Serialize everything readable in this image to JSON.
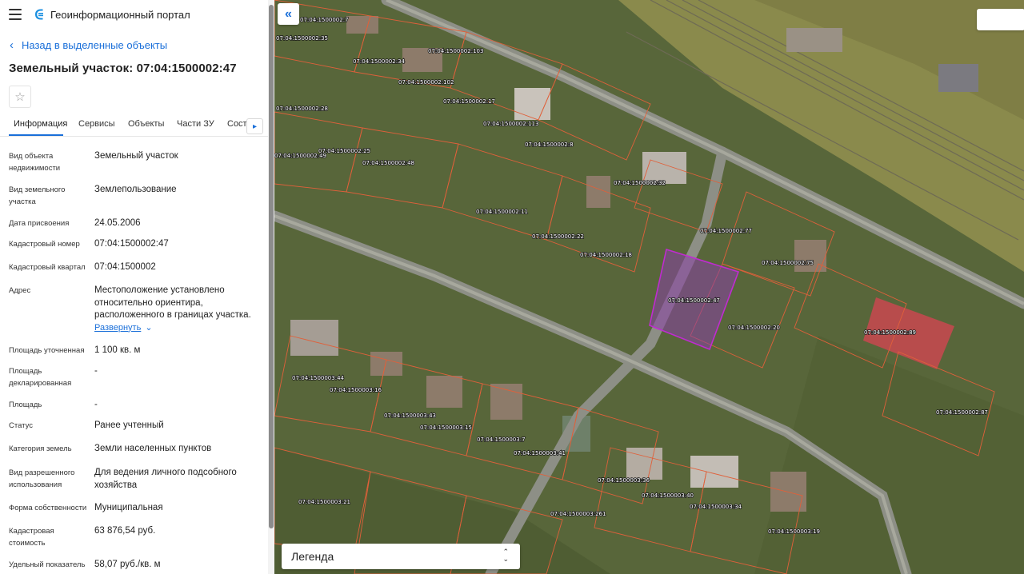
{
  "app": {
    "title": "Геоинформационный портал"
  },
  "panel": {
    "back_label": "Назад в выделенные объекты",
    "object_title": "Земельный участок: 07:04:1500002:47",
    "tabs": [
      "Информация",
      "Сервисы",
      "Объекты",
      "Части ЗУ",
      "Соста"
    ],
    "properties": [
      {
        "label": "Вид объекта недвижимости",
        "value": "Земельный участок"
      },
      {
        "label": "Вид земельного участка",
        "value": "Землепользование"
      },
      {
        "label": "Дата присвоения",
        "value": "24.05.2006"
      },
      {
        "label": "Кадастровый номер",
        "value": "07:04:1500002:47"
      },
      {
        "label": "Кадастровый квартал",
        "value": "07:04:1500002"
      },
      {
        "label": "Адрес",
        "value": "Местоположение установлено относительно ориентира, расположенного в границах участка.",
        "link": "Развернуть"
      },
      {
        "label": "Площадь уточненная",
        "value": "1 100 кв. м"
      },
      {
        "label": "Площадь декларированная",
        "value": "-"
      },
      {
        "label": "Площадь",
        "value": "-"
      },
      {
        "label": "Статус",
        "value": "Ранее учтенный"
      },
      {
        "label": "Категория земель",
        "value": "Земли населенных пунктов"
      },
      {
        "label": "Вид разрешенного использования",
        "value": "Для ведения личного подсобного хозяйства"
      },
      {
        "label": "Форма собственности",
        "value": "Муниципальная"
      },
      {
        "label": "Кадастровая стоимость",
        "value": "63 876,54 руб."
      },
      {
        "label": "Удельный показатель",
        "value": "58,07 руб./кв. м"
      }
    ]
  },
  "map": {
    "legend_label": "Легенда",
    "parcel_labels": [
      "07:04:1500002:7",
      "07:04:1500002:35",
      "07:04:1500002:34",
      "07:04:1500002:103",
      "07:04:1500002:102",
      "07:04:1500002:17",
      "07:04:1500002:28",
      "07:04:1500002:113",
      "07:04:1500002:8",
      "07:04:1500002:49",
      "07:04:1500002:25",
      "07:04:1500002:48",
      "07:04:1500002:32",
      "07:04:1500002:11",
      "07:04:1500002:22",
      "07:04:1500002:77",
      "07:04:1500002:18",
      "07:04:1500002:75",
      "07:04:1500002:47",
      "07:04:1500002:20",
      "07:04:1500002:89",
      "07:04:1500003:44",
      "07:04:1500003:16",
      "07:04:1500003:43",
      "07:04:1500003:15",
      "07:04:1500003:7",
      "07:04:1500003:41",
      "07:04:1500002:87",
      "07:04:1500003:36",
      "07:04:1500003:40",
      "07:04:1500003:34",
      "07:04:1500003:21",
      "07:04:1500003:261",
      "07:04:1500003:19"
    ],
    "selected_parcel": "07:04:1500002:47",
    "colors": {
      "parcel_border": "#e0603a",
      "selected_border": "#c02bd1",
      "accent": "#1a6fd9"
    }
  }
}
